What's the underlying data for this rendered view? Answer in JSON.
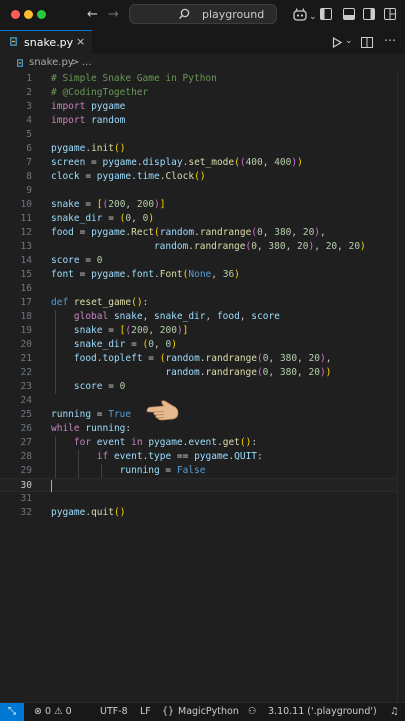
{
  "titlebar": {
    "search_label": "playground",
    "search_icon": "magnifier",
    "nav_back": "←",
    "nav_forward": "→"
  },
  "tabs": [
    {
      "label": "snake.py",
      "close": "×"
    }
  ],
  "breadcrumb": {
    "file": "snake.py",
    "separator": ">",
    "rest": "..."
  },
  "code_lines": [
    {
      "n": "1",
      "c": "# Simple Snake Game in Python"
    },
    {
      "n": "2",
      "c": "# @CodingTogether"
    },
    {
      "n": "3",
      "c": "import pygame"
    },
    {
      "n": "4",
      "c": "import random"
    },
    {
      "n": "5",
      "c": ""
    },
    {
      "n": "6",
      "c": "pygame.init()"
    },
    {
      "n": "7",
      "c": "screen = pygame.display.set_mode((400, 400))"
    },
    {
      "n": "8",
      "c": "clock = pygame.time.Clock()"
    },
    {
      "n": "9",
      "c": ""
    },
    {
      "n": "10",
      "c": "snake = [(200, 200)]"
    },
    {
      "n": "11",
      "c": "snake_dir = (0, 0)"
    },
    {
      "n": "12",
      "c": "food = pygame.Rect(random.randrange(0, 380, 20),"
    },
    {
      "n": "13",
      "c": "                  random.randrange(0, 380, 20), 20, 20)"
    },
    {
      "n": "14",
      "c": "score = 0"
    },
    {
      "n": "15",
      "c": "font = pygame.font.Font(None, 36)"
    },
    {
      "n": "16",
      "c": ""
    },
    {
      "n": "17",
      "c": "def reset_game():"
    },
    {
      "n": "18",
      "c": "    global snake, snake_dir, food, score"
    },
    {
      "n": "19",
      "c": "    snake = [(200, 200)]"
    },
    {
      "n": "20",
      "c": "    snake_dir = (0, 0)"
    },
    {
      "n": "21",
      "c": "    food.topleft = (random.randrange(0, 380, 20),"
    },
    {
      "n": "22",
      "c": "                    random.randrange(0, 380, 20))"
    },
    {
      "n": "23",
      "c": "    score = 0"
    },
    {
      "n": "24",
      "c": ""
    },
    {
      "n": "25",
      "c": "running = True"
    },
    {
      "n": "26",
      "c": "while running:"
    },
    {
      "n": "27",
      "c": "    for event in pygame.event.get():"
    },
    {
      "n": "28",
      "c": "        if event.type == pygame.QUIT:"
    },
    {
      "n": "29",
      "c": "            running = False"
    },
    {
      "n": "30",
      "c": ""
    },
    {
      "n": "31",
      "c": ""
    },
    {
      "n": "32",
      "c": "pygame.quit()"
    }
  ],
  "active_line": "30",
  "status": {
    "errors": "0",
    "warnings": "0",
    "encoding": "UTF-8",
    "eol": "LF",
    "language": "MagicPython",
    "interpreter": "3.10.11 ('.playground')"
  },
  "colors": {
    "comment": "#6a9955",
    "keyword_control": "#c586c0",
    "keyword_def": "#569cd6",
    "function": "#dcdcaa",
    "variable": "#9cdcfe",
    "number": "#b5cea8",
    "bracket1": "#ffd700",
    "bracket2": "#da70d6",
    "bracket3": "#179fff",
    "accent": "#0078d4"
  }
}
